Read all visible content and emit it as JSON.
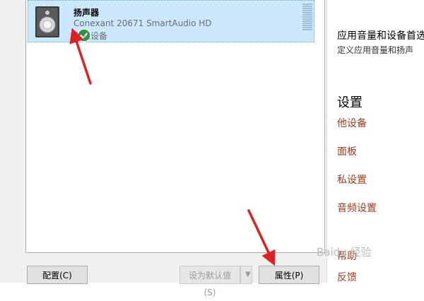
{
  "device": {
    "name": "扬声器",
    "description": "Conexant 20671 SmartAudio HD",
    "status": "默认设备",
    "icon": "speaker-icon",
    "badge_icon": "check-icon"
  },
  "buttons": {
    "configure": "配置(C)",
    "set_default": "设为默认值(S)",
    "set_default_arrow": "▼",
    "properties": "属性(P)"
  },
  "right_panel": {
    "title": "应用音量和设备首选",
    "subtitle": "定义应用音量和扬声",
    "heading": "设置",
    "links": [
      "他设备",
      "面板",
      "私设置",
      "音频设置",
      "帮助",
      "反馈"
    ]
  },
  "watermark": "Baidu 经验",
  "colors": {
    "selection": "#cce8ff",
    "link": "#a33a1b",
    "annotation_arrow": "#e02020",
    "check_badge": "#1e9b3c"
  }
}
